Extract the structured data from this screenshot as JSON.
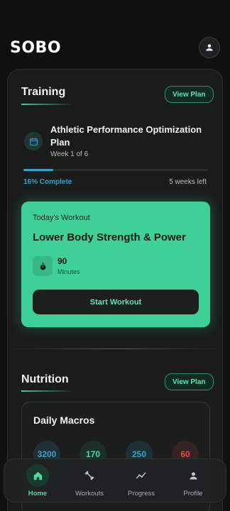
{
  "app": {
    "logo": "SOBO"
  },
  "colors": {
    "accent": "#3fcf98",
    "progress": "#3aa0c8",
    "calories": "#3aa0c8",
    "protein": "#4fd9a3",
    "carbs": "#3aa0c8",
    "fat": "#e0524a"
  },
  "training": {
    "title": "Training",
    "view_plan": "View Plan",
    "plan": {
      "icon": "calendar-icon",
      "name": "Athletic Performance Optimization Plan",
      "week": "Week 1 of 6",
      "progress_percent": 16,
      "progress_label": "16% Complete",
      "time_left": "5 weeks left"
    },
    "today": {
      "label": "Today's Workout",
      "name": "Lower Body Strength & Power",
      "duration": "90",
      "duration_unit": "Minutes",
      "start_label": "Start Workout"
    }
  },
  "nutrition": {
    "title": "Nutrition",
    "view_plan": "View Plan",
    "macros_title": "Daily Macros",
    "macros": [
      {
        "value": "3200"
      },
      {
        "value": "170"
      },
      {
        "value": "250"
      },
      {
        "value": "60"
      }
    ]
  },
  "nav": {
    "items": [
      {
        "label": "Home",
        "icon": "home-icon",
        "active": true
      },
      {
        "label": "Workouts",
        "icon": "dumbbell-icon",
        "active": false
      },
      {
        "label": "Progress",
        "icon": "trend-icon",
        "active": false
      },
      {
        "label": "Profile",
        "icon": "person-icon",
        "active": false
      }
    ]
  }
}
